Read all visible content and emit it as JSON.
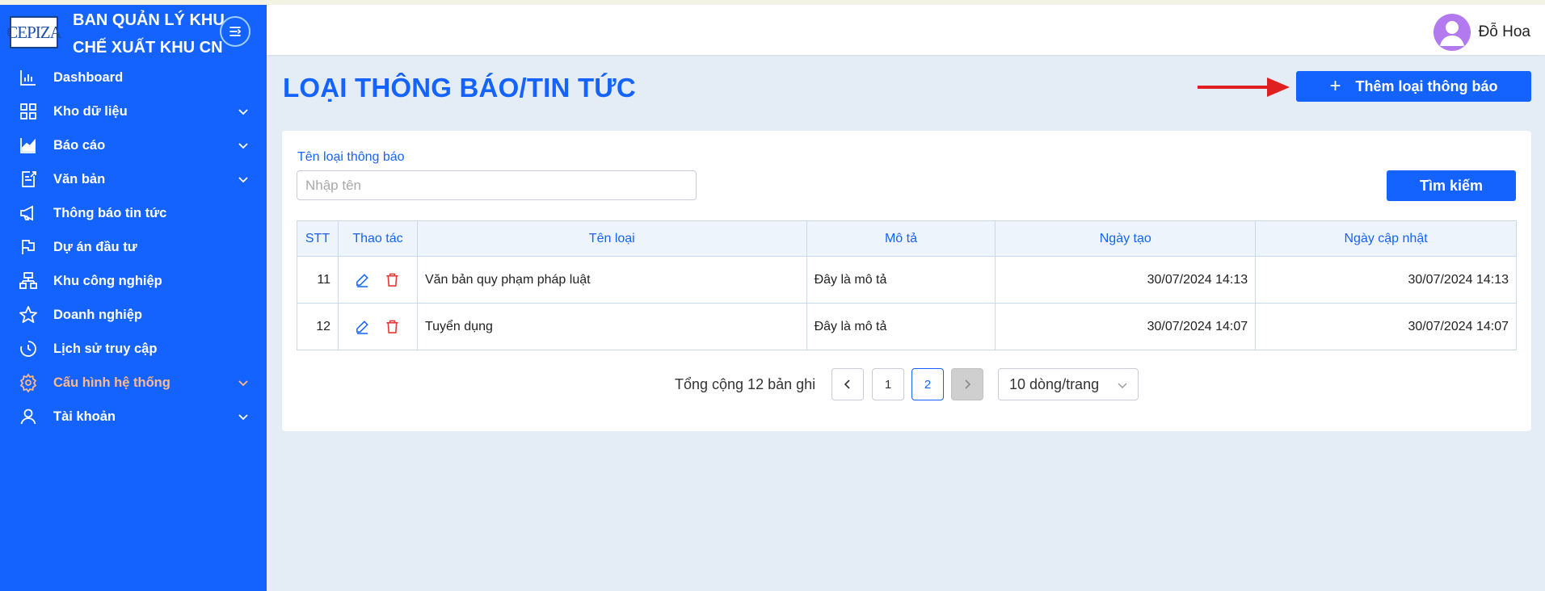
{
  "brand": {
    "logo_text": "CEPIZA",
    "title_line1": "BAN QUẢN LÝ KHU",
    "title_line2": "CHẾ XUẤT KHU CN"
  },
  "sidebar": {
    "items": [
      {
        "label": "Dashboard",
        "icon": "bar-chart-icon",
        "has_submenu": false
      },
      {
        "label": "Kho dữ liệu",
        "icon": "grid-icon",
        "has_submenu": true
      },
      {
        "label": "Báo cáo",
        "icon": "area-chart-icon",
        "has_submenu": true
      },
      {
        "label": "Văn bản",
        "icon": "document-export-icon",
        "has_submenu": true
      },
      {
        "label": "Thông báo tin tức",
        "icon": "megaphone-icon",
        "has_submenu": false
      },
      {
        "label": "Dự án đầu tư",
        "icon": "flag-icon",
        "has_submenu": false
      },
      {
        "label": "Khu công nghiệp",
        "icon": "cluster-icon",
        "has_submenu": false
      },
      {
        "label": "Doanh nghiệp",
        "icon": "star-icon",
        "has_submenu": false
      },
      {
        "label": "Lịch sử truy cập",
        "icon": "history-icon",
        "has_submenu": false
      },
      {
        "label": "Cấu hình hệ thống",
        "icon": "gear-icon",
        "has_submenu": true,
        "active": true
      },
      {
        "label": "Tài khoản",
        "icon": "user-icon",
        "has_submenu": true
      }
    ]
  },
  "header": {
    "username": "Đỗ Hoa"
  },
  "page": {
    "title": "LOẠI THÔNG BÁO/TIN TỨC",
    "add_button_label": "Thêm loại thông báo"
  },
  "filter": {
    "label": "Tên loại thông báo",
    "placeholder": "Nhập tên",
    "value": "",
    "search_label": "Tìm kiếm"
  },
  "table": {
    "columns": [
      "STT",
      "Thao tác",
      "Tên loại",
      "Mô tả",
      "Ngày tạo",
      "Ngày cập nhật"
    ],
    "rows": [
      {
        "stt": "11",
        "name": "Văn bản quy phạm pháp luật",
        "desc": "Đây là mô tả",
        "created": "30/07/2024 14:13",
        "updated": "30/07/2024 14:13"
      },
      {
        "stt": "12",
        "name": "Tuyển dụng",
        "desc": "Đây là mô tả",
        "created": "30/07/2024 14:07",
        "updated": "30/07/2024 14:07"
      }
    ]
  },
  "pagination": {
    "total_text": "Tổng cộng 12 bản ghi",
    "pages": [
      "1",
      "2"
    ],
    "current_page": "2",
    "page_size": "10 dòng/trang"
  },
  "colors": {
    "primary": "#1463ff",
    "active_menu": "#ffb98a",
    "delete": "#e53935",
    "annotation_arrow": "#e02020"
  }
}
